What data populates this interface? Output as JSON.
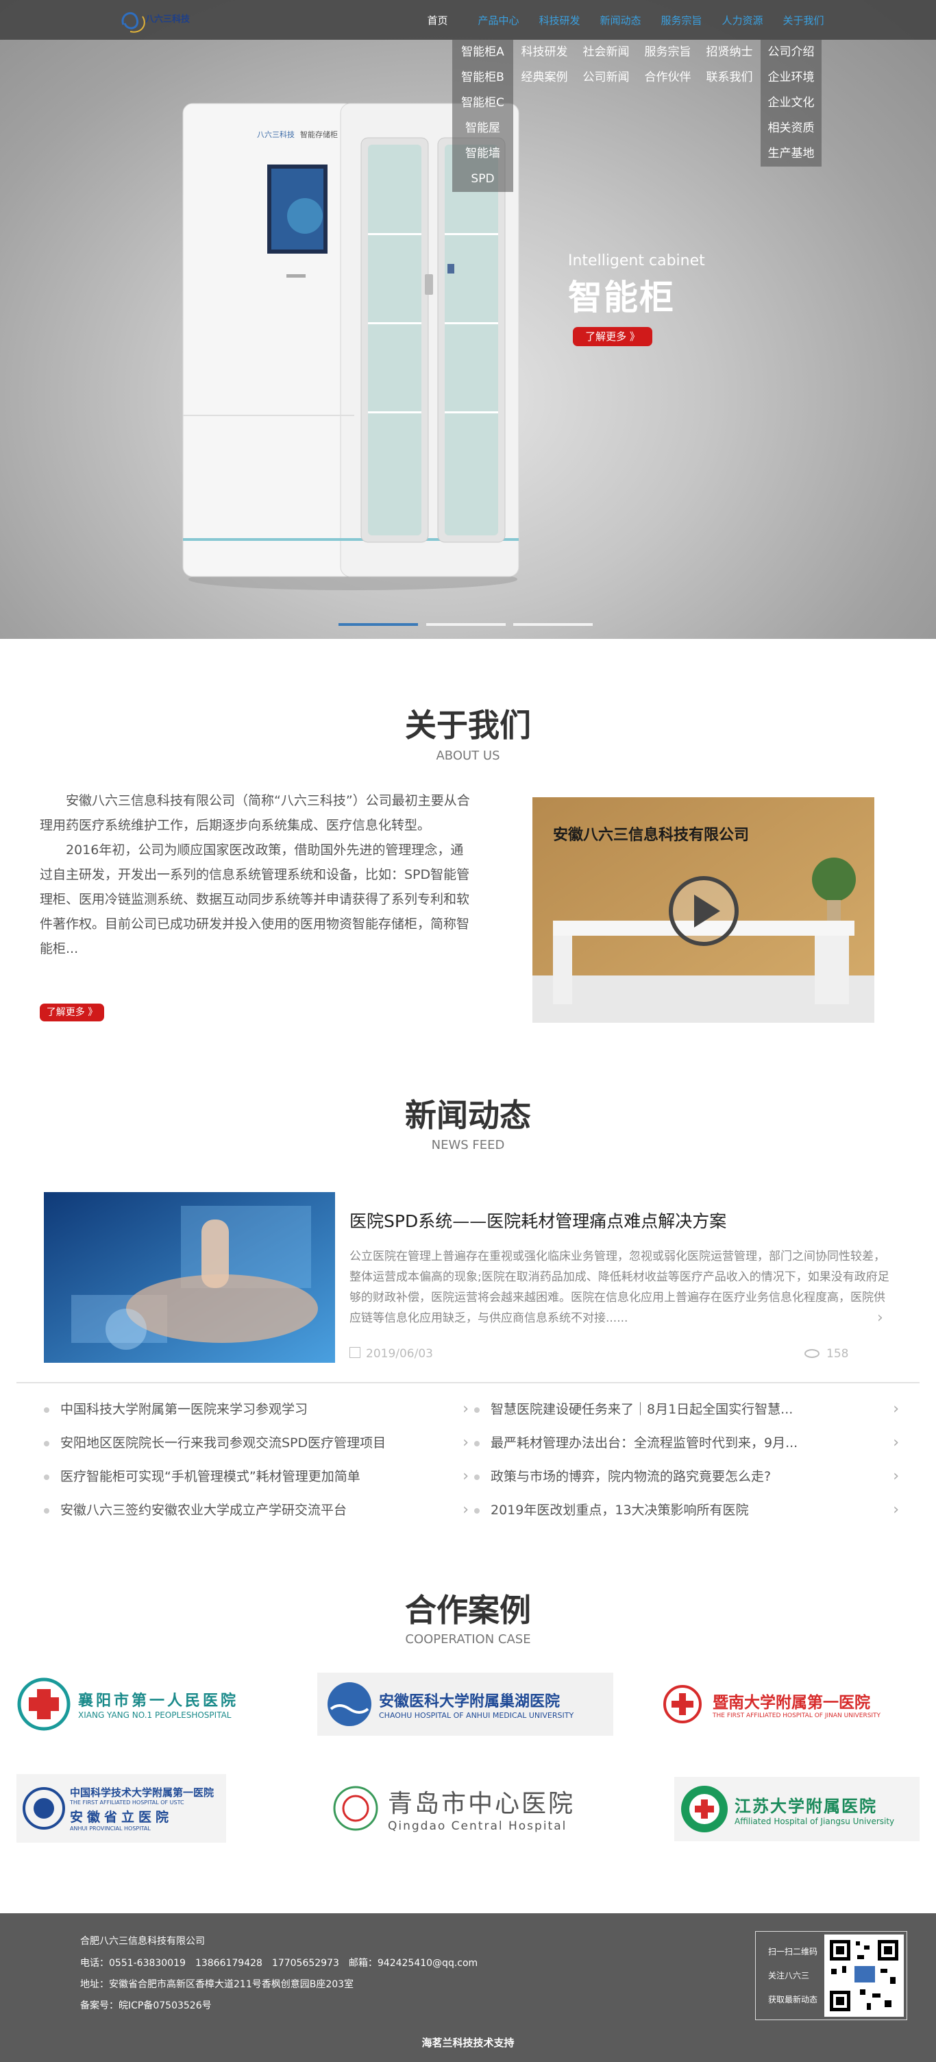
{
  "header": {
    "logo_text": "八六三科技",
    "nav": [
      "首页",
      "产品中心",
      "科技研发",
      "新闻动态",
      "服务宗旨",
      "人力资源",
      "关于我们"
    ]
  },
  "dropdowns": {
    "products": [
      "智能柜A",
      "智能柜B",
      "智能柜C",
      "智能屋",
      "智能墙",
      "SPD"
    ],
    "research": [
      "科技研发",
      "经典案例"
    ],
    "news": [
      "社会新闻",
      "公司新闻"
    ],
    "service": [
      "服务宗旨",
      "合作伙伴"
    ],
    "hr": [
      "招贤纳士",
      "联系我们"
    ],
    "about": [
      "公司介绍",
      "企业环境",
      "企业文化",
      "相关资质",
      "生产基地"
    ]
  },
  "hero": {
    "cabinet_brand": "八六三科技",
    "cabinet_label": "智能存储柜",
    "subtitle_en": "Intelligent cabinet",
    "title_cn": "智能柜",
    "button": "了解更多 》",
    "bullet_active": 0
  },
  "about": {
    "title": "关于我们",
    "subtitle": "ABOUT US",
    "para1": "安徽八六三信息科技有限公司（简称“八六三科技”）公司最初主要从合理用药医疗系统维护工作，后期逐步向系统集成、医疗信息化转型。",
    "para2": "2016年初，公司为顺应国家医改政策，借助国外先进的管理理念，通过自主研发，开发出一系列的信息系统管理系统和设备，比如：SPD智能管理柜、医用冷链监测系统、数据互动同步系统等并申请获得了系列专利和软件著作权。目前公司已成功研发并投入使用的医用物资智能存储柜，简称智能柜...",
    "button": "了解更多 》",
    "image_sign": "安徽八六三信息科技有限公司"
  },
  "news": {
    "title": "新闻动态",
    "subtitle": "NEWS FEED",
    "featured": {
      "title": "医院SPD系统——医院耗材管理痛点难点解决方案",
      "desc": "公立医院在管理上普遍存在重视或强化临床业务管理，忽视或弱化医院运营管理，部门之间协同性较差，整体运营成本偏高的现象;医院在取消药品加成、降低耗材收益等医疗产品收入的情况下，如果没有政府足够的财政补偿，医院运营将会越来越困难。医院在信息化应用上普遍存在医疗业务信息化程度高，医院供应链等信息化应用缺乏，与供应商信息系统不对接......",
      "date": "2019/06/03",
      "views": "158"
    },
    "list_left": [
      "中国科技大学附属第一医院来学习参观学习",
      "安阳地区医院院长一行来我司参观交流SPD医疗管理项目",
      "医疗智能柜可实现“手机管理模式”耗材管理更加简单",
      "安徽八六三签约安徽农业大学成立产学研交流平台"
    ],
    "list_right": [
      "智慧医院建设硬任务来了｜8月1日起全国实行智慧...",
      "最严耗材管理办法出台：全流程监管时代到来，9月...",
      "政策与市场的博弈，院内物流的路究竟要怎么走?",
      "2019年医改划重点，13大决策影响所有医院"
    ]
  },
  "cases": {
    "title": "合作案例",
    "subtitle": "COOPERATION CASE",
    "logos": [
      {
        "cn": "襄阳市第一人民医院",
        "en": "XIANG YANG NO.1 PEOPLESHOSPITAL"
      },
      {
        "cn": "安徽医科大学附属巢湖医院",
        "en": "CHAOHU HOSPITAL OF ANHUI MEDICAL UNIVERSITY"
      },
      {
        "cn": "暨南大学附属第一医院",
        "en": "THE FIRST AFFILIATED HOSPITAL OF JINAN UNIVERSITY"
      },
      {
        "cn": "中国科学技术大学附属第一医院",
        "en": "THE FIRST AFFILIATED HOSPITAL OF USTC",
        "cn2": "安徽省立医院",
        "en2": "ANHUI PROVINCIAL HOSPITAL"
      },
      {
        "cn": "青岛市中心医院",
        "en": "Qingdao Central Hospital"
      },
      {
        "cn": "江苏大学附属医院",
        "en": "Affiliated Hospital of Jiangsu University"
      }
    ]
  },
  "footer": {
    "company": "合肥八六三信息科技有限公司",
    "phone": "电话：0551-63830019　13866179428　17705652973　邮箱：942425410@qq.com",
    "address": "地址：安徽省合肥市高新区香樟大道211号香枫创意园B座203室",
    "icp": "备案号：皖ICP备07503526号",
    "qr_lines": [
      "扫一扫二维码",
      "关注八六三",
      "获取最新动态"
    ],
    "support": "海茗兰科技技术支持"
  }
}
